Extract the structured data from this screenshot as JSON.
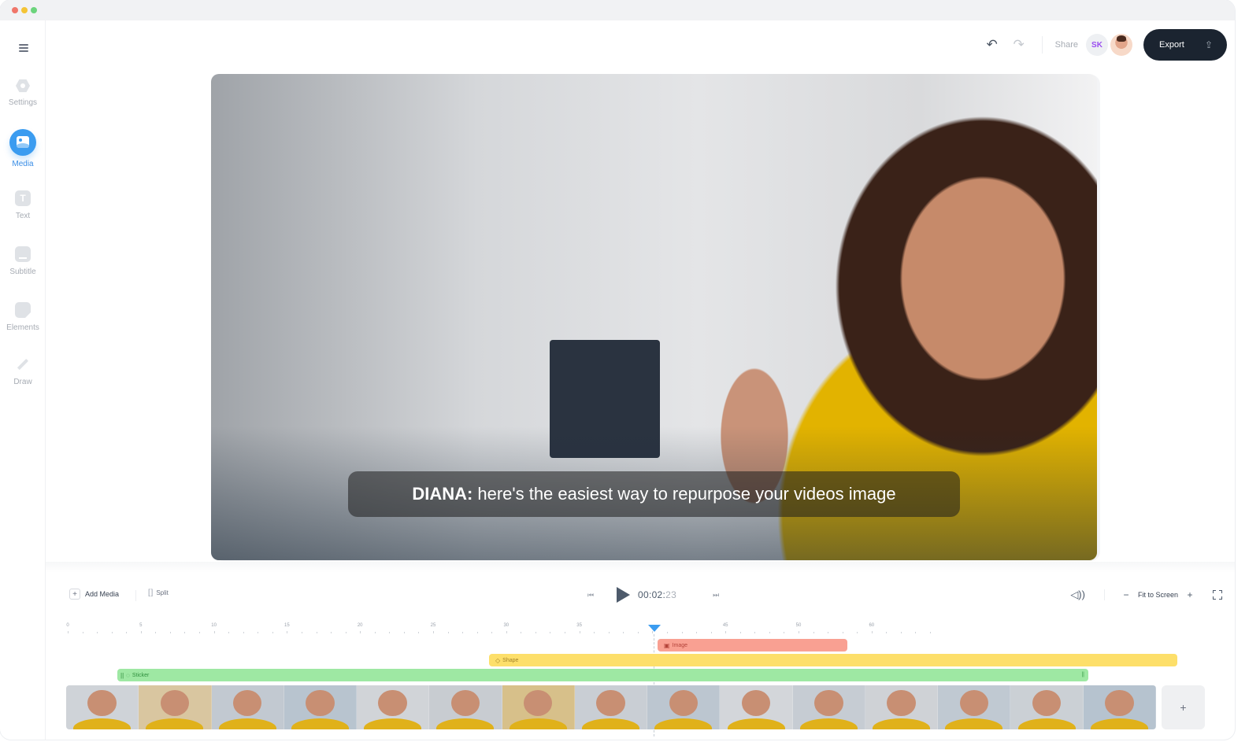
{
  "window": {
    "traffic_lights": [
      "close",
      "minimize",
      "maximize"
    ]
  },
  "sidebar": {
    "menu_icon": "hamburger-icon",
    "items": [
      {
        "label": "Settings",
        "icon": "settings-icon",
        "active": false
      },
      {
        "label": "Media",
        "icon": "media-icon",
        "active": true
      },
      {
        "label": "Text",
        "icon": "text-icon",
        "active": false
      },
      {
        "label": "Subtitle",
        "icon": "subtitle-icon",
        "active": false
      },
      {
        "label": "Elements",
        "icon": "elements-icon",
        "active": false
      },
      {
        "label": "Draw",
        "icon": "draw-icon",
        "active": false
      }
    ]
  },
  "topbar": {
    "undo_icon": "↶",
    "redo_icon": "↷",
    "share_label": "Share",
    "avatar_initials": "SK",
    "export_label": "Export",
    "export_icon": "⇪"
  },
  "video": {
    "subtitle_speaker": "DIANA:",
    "subtitle_text": "here's the easiest way to repurpose your videos image"
  },
  "timeline_toolbar": {
    "add_media_label": "Add Media",
    "add_media_icon": "+",
    "split_label": "Split",
    "split_icon": "[ ]",
    "skip_back_icon": "⏮",
    "skip_forward_icon": "⏭",
    "time_main": "00:02:",
    "time_frames": "23",
    "volume_icon": "🔊",
    "zoom_out_icon": "−",
    "fit_label": "Fit to Screen",
    "zoom_in_icon": "+"
  },
  "ruler": {
    "labels": [
      "0",
      "5",
      "10",
      "15",
      "20",
      "25",
      "30",
      "35",
      "",
      "45",
      "50",
      "60"
    ],
    "playhead_seconds": 40
  },
  "tracks": {
    "image": {
      "label": "Image",
      "icon": "▣"
    },
    "shape": {
      "label": "Shape",
      "icon": "◇"
    },
    "sticker": {
      "label": "Sticker",
      "icon": "◌",
      "handle": "||"
    }
  },
  "filmstrip": {
    "frame_count": 15,
    "add_clip_icon": "+"
  }
}
